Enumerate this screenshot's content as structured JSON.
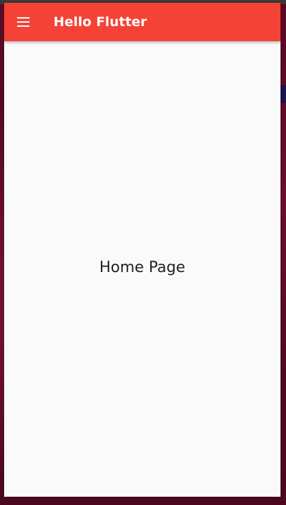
{
  "app_bar": {
    "title": "Hello Flutter",
    "menu_icon": "menu-icon",
    "color": "#f44336"
  },
  "body": {
    "text": "Home Page",
    "background": "#fafafa"
  }
}
